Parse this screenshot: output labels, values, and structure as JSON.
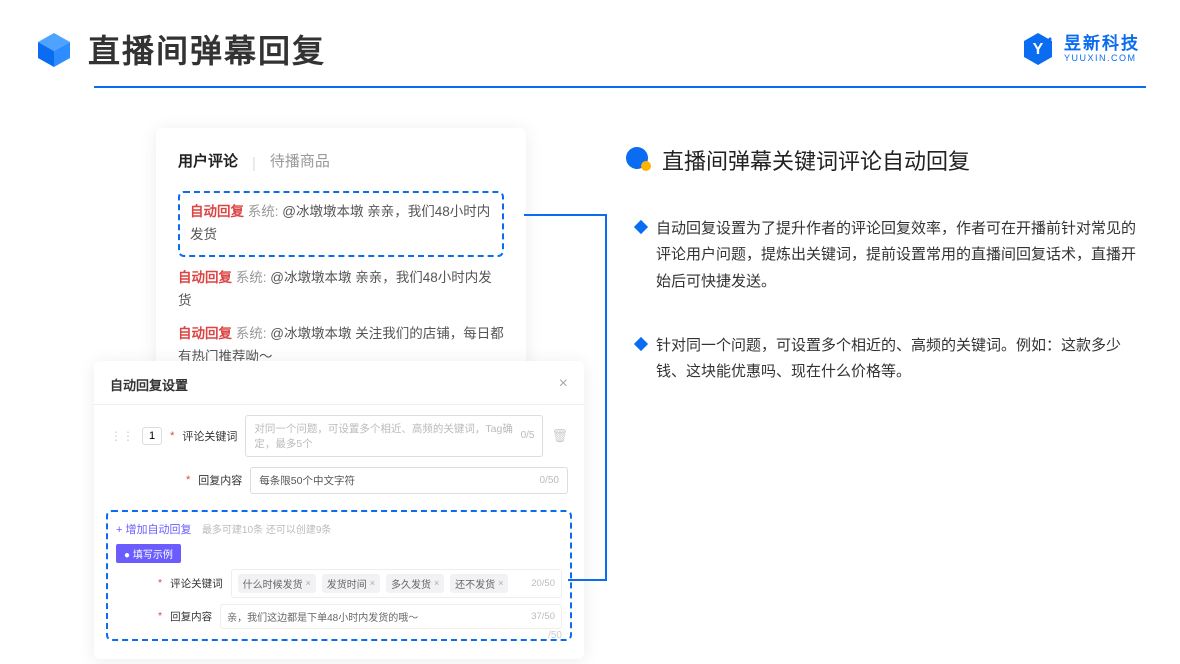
{
  "header": {
    "title": "直播间弹幕回复",
    "brand_cn": "昱新科技",
    "brand_en": "YUUXIN.COM"
  },
  "comments_panel": {
    "tab_active": "用户评论",
    "tab_inactive": "待播商品",
    "highlighted": {
      "tag": "自动回复",
      "sys": "系统:",
      "body": "@冰墩墩本墩 亲亲，我们48小时内发货"
    },
    "lines": [
      {
        "tag": "自动回复",
        "sys": "系统:",
        "body": "@冰墩墩本墩 亲亲，我们48小时内发货"
      },
      {
        "tag": "自动回复",
        "sys": "系统:",
        "body": "@冰墩墩本墩 关注我们的店铺，每日都有热门推荐呦～"
      }
    ]
  },
  "settings": {
    "title": "自动回复设置",
    "index": "1",
    "keyword_label": "评论关键词",
    "keyword_placeholder": "对同一个问题，可设置多个相近、高频的关键词，Tag确定，最多5个",
    "keyword_count": "0/5",
    "content_label": "回复内容",
    "content_placeholder": "每条限50个中文字符",
    "content_count": "0/50",
    "add_link": "+ 增加自动回复",
    "add_hint": "最多可建10条 还可以创建9条",
    "example_badge": "● 填写示例",
    "example": {
      "kw_label": "评论关键词",
      "chips": [
        "什么时候发货",
        "发货时间",
        "多久发货",
        "还不发货"
      ],
      "kw_count": "20/50",
      "content_label": "回复内容",
      "content_value": "亲，我们这边都是下单48小时内发货的哦～",
      "content_count": "37/50"
    },
    "faded_count": "/50"
  },
  "right": {
    "section_title": "直播间弹幕关键词评论自动回复",
    "bullets": [
      "自动回复设置为了提升作者的评论回复效率，作者可在开播前针对常见的评论用户问题，提炼出关键词，提前设置常用的直播间回复话术，直播开始后可快捷发送。",
      "针对同一个问题，可设置多个相近的、高频的关键词。例如：这款多少钱、这块能优惠吗、现在什么价格等。"
    ]
  }
}
